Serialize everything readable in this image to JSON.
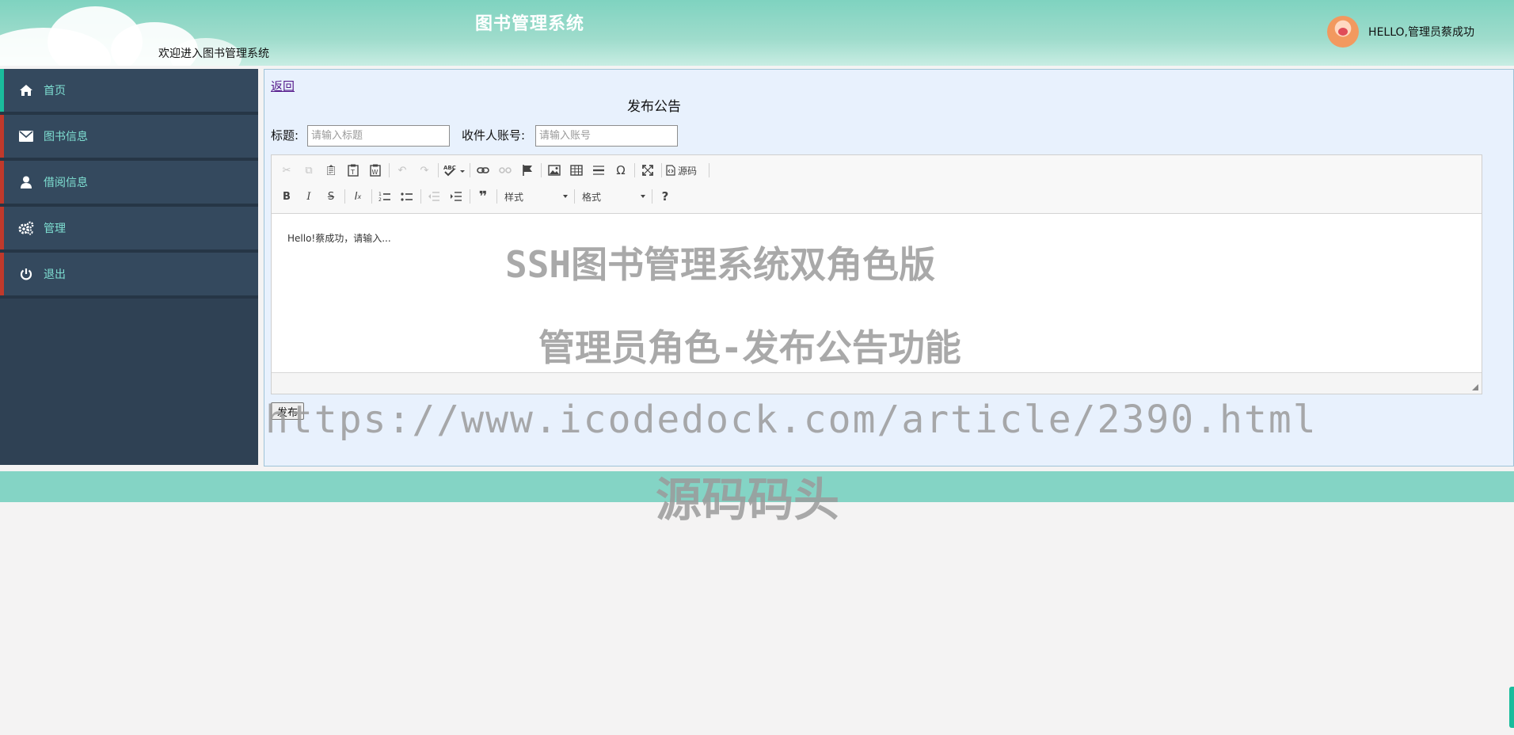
{
  "header": {
    "title": "图书管理系统",
    "subtitle": "欢迎进入图书管理系统",
    "user_greeting": "HELLO,管理员蔡成功"
  },
  "sidebar": {
    "items": [
      {
        "label": "首页",
        "icon": "home-icon"
      },
      {
        "label": "图书信息",
        "icon": "envelope-icon"
      },
      {
        "label": "借阅信息",
        "icon": "user-icon"
      },
      {
        "label": "管理",
        "icon": "gears-icon"
      },
      {
        "label": "退出",
        "icon": "power-icon"
      }
    ]
  },
  "main": {
    "back_link": "返回",
    "form_title": "发布公告",
    "title_label": "标题:",
    "title_placeholder": "请输入标题",
    "recipient_label": "收件人账号:",
    "recipient_placeholder": "请输入账号",
    "editor": {
      "source_label": "源码",
      "styles_combo": "样式",
      "format_combo": "格式",
      "help_label": "?",
      "content": "Hello!蔡成功，请输入..."
    },
    "publish_button": "发布"
  },
  "watermarks": {
    "line1": "SSH图书管理系统双角色版",
    "line2": "管理员角色-发布公告功能",
    "url": "https://www.icodedock.com/article/2390.html",
    "brand": "源码码头"
  },
  "colors": {
    "header": "#7fd3c0",
    "sidebar": "#34495e",
    "sidebar_accent_active": "#1abc9c",
    "sidebar_accent": "#c0392b",
    "nav_text": "#7fe0d3",
    "content_bg": "#e8f1fd",
    "footer": "#84d4c5"
  }
}
